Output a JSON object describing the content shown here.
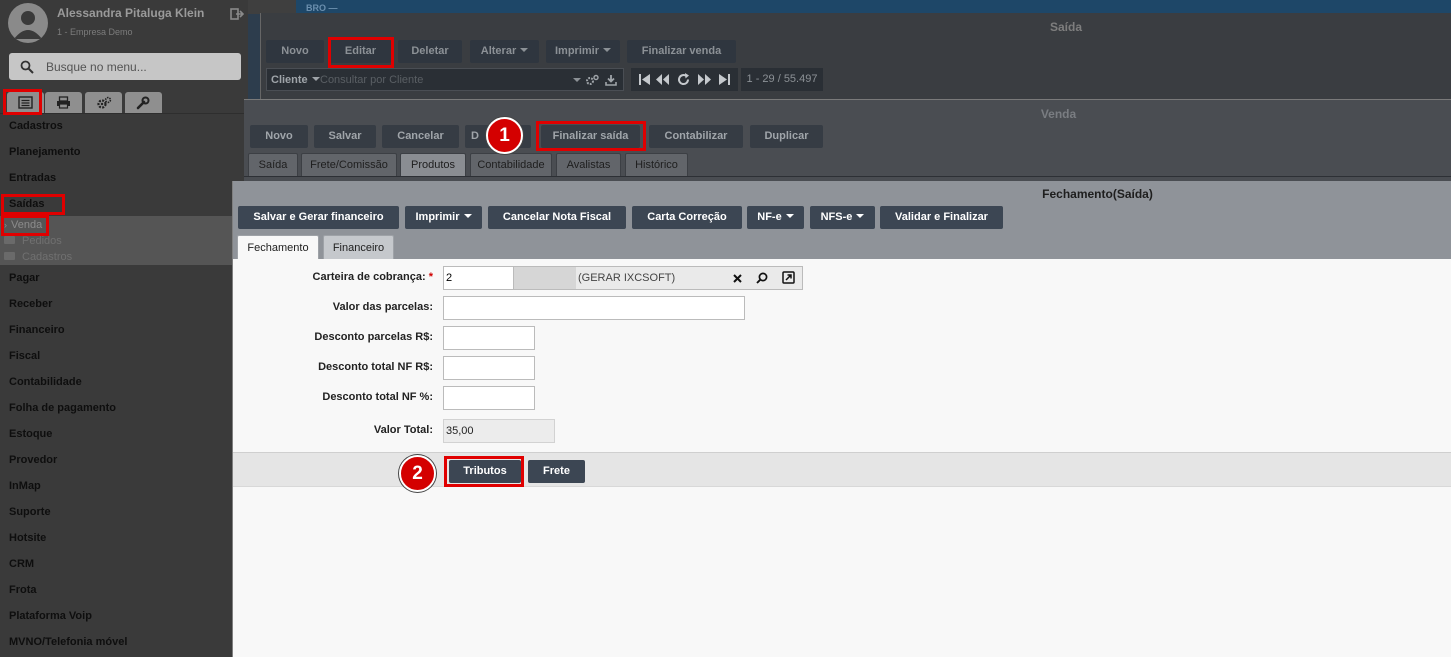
{
  "user": {
    "name": "Alessandra Pitaluga Klein",
    "company": "1 - Empresa Demo"
  },
  "search": {
    "placeholder": "Busque no menu..."
  },
  "sidebar": {
    "items": [
      "Cadastros",
      "Planejamento",
      "Entradas",
      "Saídas"
    ],
    "sub_selected": "Venda",
    "sub_folders": [
      "Pedidos",
      "Cadastros"
    ],
    "items_after": [
      "Pagar",
      "Receber",
      "Financeiro",
      "Fiscal",
      "Contabilidade",
      "Folha de pagamento",
      "Estoque",
      "Provedor",
      "InMap",
      "Suporte",
      "Hotsite",
      "CRM",
      "Frota",
      "Plataforma Voip",
      "MVNO/Telefonia móvel"
    ]
  },
  "saida_window": {
    "title": "Saída",
    "top_fragment": "BRO —",
    "buttons": {
      "novo": "Novo",
      "editar": "Editar",
      "deletar": "Deletar",
      "alterar": "Alterar",
      "imprimir": "Imprimir",
      "finalizar_venda": "Finalizar venda"
    },
    "filter": {
      "field": "Cliente",
      "placeholder": "Consultar por Cliente"
    },
    "pager": "1 - 29 / 55.497"
  },
  "venda_window": {
    "title": "Venda",
    "buttons": {
      "novo": "Novo",
      "salvar": "Salvar",
      "cancelar": "Cancelar",
      "d": "D",
      "finalizar_saida": "Finalizar saída",
      "contabilizar": "Contabilizar",
      "duplicar": "Duplicar"
    },
    "tabs": [
      "Saída",
      "Frete/Comissão",
      "Produtos",
      "Contabilidade",
      "Avalistas",
      "Histórico"
    ]
  },
  "fechamento_window": {
    "title": "Fechamento(Saída)",
    "buttons": {
      "salvar_gerar": "Salvar e Gerar financeiro",
      "imprimir": "Imprimir",
      "cancelar_nf": "Cancelar Nota Fiscal",
      "carta": "Carta Correção",
      "nfe": "NF-e",
      "nfse": "NFS-e",
      "validar": "Validar e Finalizar"
    },
    "tabs": [
      "Fechamento",
      "Financeiro"
    ],
    "form": {
      "carteira_label": "Carteira de cobrança:",
      "carteira_code": "2",
      "carteira_desc": "(GERAR IXCSOFT)",
      "valor_parcelas_label": "Valor das parcelas:",
      "desconto_parcelas_label": "Desconto parcelas R$:",
      "desconto_total_label": "Desconto total NF R$:",
      "desconto_pct_label": "Desconto total NF %:",
      "valor_total_label": "Valor Total:",
      "valor_total": "35,00"
    },
    "footer_buttons": {
      "tributos": "Tributos",
      "frete": "Frete"
    }
  },
  "badges": [
    "1",
    "2"
  ],
  "colors": {
    "highlight": "#e00000",
    "button": "#3c4653",
    "badge": "#d40000"
  }
}
